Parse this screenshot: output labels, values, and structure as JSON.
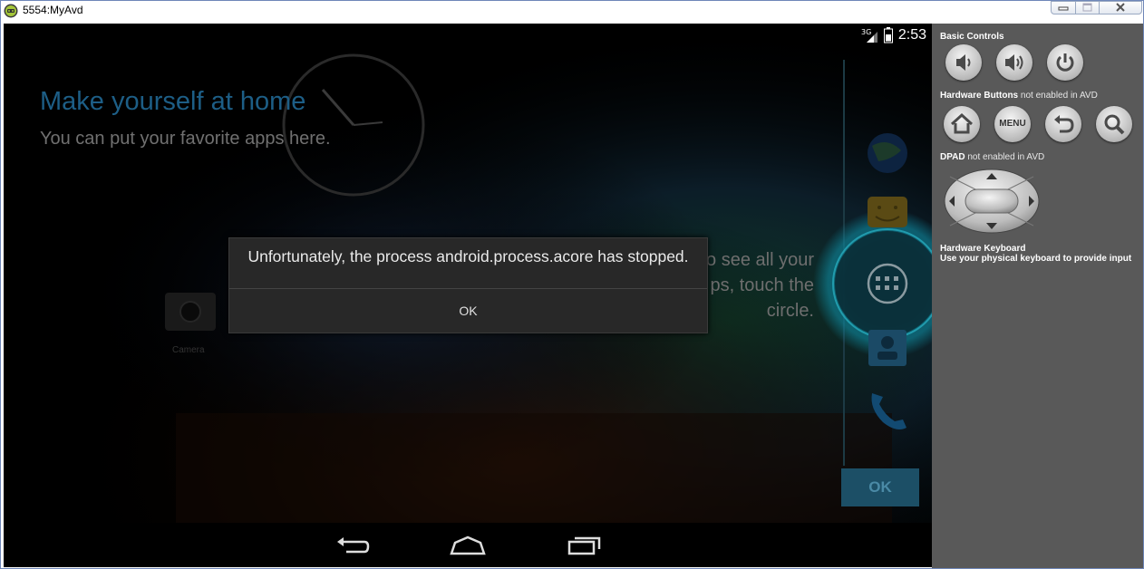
{
  "window": {
    "title": "5554:MyAvd"
  },
  "status_bar": {
    "network": "3G",
    "time": "2:53"
  },
  "home_cling": {
    "title": "Make yourself at home",
    "subtitle": "You can put your favorite apps here.",
    "allapps_hint_lines": [
      "o see all your",
      "ps, touch the",
      "circle."
    ],
    "ok_label": "OK",
    "camera_label": "Camera"
  },
  "dialog": {
    "message": "Unfortunately, the process android.process.acore has stopped.",
    "ok_label": "OK"
  },
  "controls": {
    "basic_title": "Basic Controls",
    "hardware_title": "Hardware Buttons",
    "hardware_note": "not enabled in AVD",
    "menu_label": "MENU",
    "dpad_title": "DPAD",
    "dpad_note": "not enabled in AVD",
    "keyboard_title": "Hardware Keyboard",
    "keyboard_note": "Use your physical keyboard to provide input"
  },
  "colors": {
    "cling_title": "#1d5e86",
    "panel_bg": "#595959",
    "dialog_bg": "#282828"
  }
}
